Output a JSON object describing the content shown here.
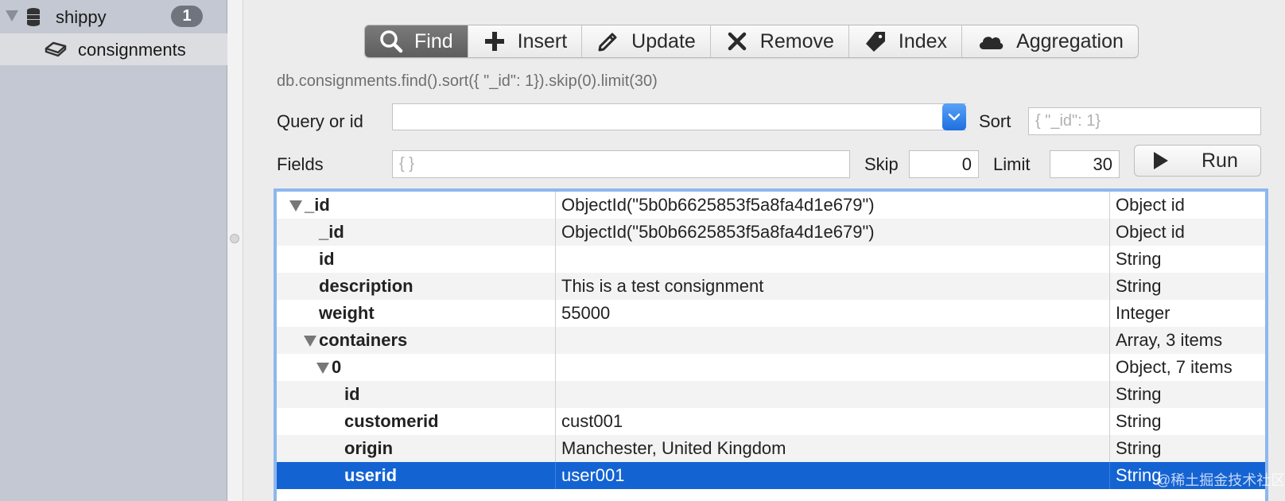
{
  "sidebar": {
    "database": {
      "name": "shippy",
      "badge": "1",
      "icon": "database-icon"
    },
    "collection": {
      "name": "consignments",
      "icon": "collection-icon"
    }
  },
  "toolbar": {
    "buttons": [
      {
        "label": "Find",
        "icon": "search-icon",
        "active": true
      },
      {
        "label": "Insert",
        "icon": "plus-icon"
      },
      {
        "label": "Update",
        "icon": "pencil-icon"
      },
      {
        "label": "Remove",
        "icon": "close-icon"
      },
      {
        "label": "Index",
        "icon": "tag-icon"
      },
      {
        "label": "Aggregation",
        "icon": "cloud-icon"
      }
    ]
  },
  "query": {
    "command": "db.consignments.find().sort({ \"_id\": 1}).skip(0).limit(30)",
    "query_label": "Query or id",
    "query_value": "",
    "sort_label": "Sort",
    "sort_placeholder": "{ \"_id\": 1}",
    "fields_label": "Fields",
    "fields_placeholder": "{ }",
    "skip_label": "Skip",
    "skip_value": "0",
    "limit_label": "Limit",
    "limit_value": "30",
    "run_label": "Run"
  },
  "results": {
    "rows": [
      {
        "key": "_id",
        "value": "ObjectId(\"5b0b6625853f5a8fa4d1e679\")",
        "type": "Object id",
        "depth": 0,
        "expanded": true
      },
      {
        "key": "_id",
        "value": "ObjectId(\"5b0b6625853f5a8fa4d1e679\")",
        "type": "Object id",
        "depth": 1
      },
      {
        "key": "id",
        "value": "",
        "type": "String",
        "depth": 1
      },
      {
        "key": "description",
        "value": "This is a test consignment",
        "type": "String",
        "depth": 1
      },
      {
        "key": "weight",
        "value": "55000",
        "type": "Integer",
        "depth": 1
      },
      {
        "key": "containers",
        "value": "",
        "type": "Array, 3 items",
        "depth": 1,
        "expanded": true
      },
      {
        "key": "0",
        "value": "",
        "type": "Object, 7 items",
        "depth": 2,
        "expanded": true
      },
      {
        "key": "id",
        "value": "",
        "type": "String",
        "depth": 3
      },
      {
        "key": "customerid",
        "value": "cust001",
        "type": "String",
        "depth": 3
      },
      {
        "key": "origin",
        "value": "Manchester, United Kingdom",
        "type": "String",
        "depth": 3
      },
      {
        "key": "userid",
        "value": "user001",
        "type": "String",
        "depth": 3,
        "selected": true
      }
    ]
  },
  "watermark": "@稀土掘金技术社区"
}
